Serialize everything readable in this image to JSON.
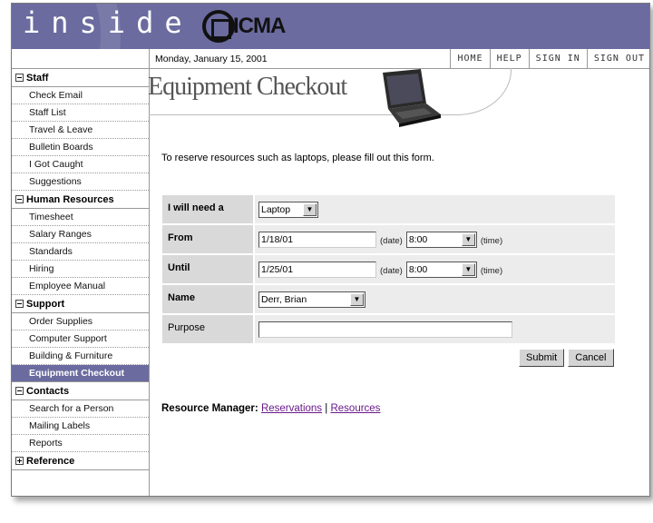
{
  "banner": {
    "word": "inside",
    "logo_text": "ICMA"
  },
  "topbar": {
    "date": "Monday, January 15, 2001",
    "links": [
      "HOME",
      "HELP",
      "SIGN IN",
      "SIGN OUT"
    ]
  },
  "sidebar": {
    "sections": [
      {
        "title": "Staff",
        "expanded": true,
        "items": [
          "Check Email",
          "Staff List",
          "Travel & Leave",
          "Bulletin Boards",
          "I Got Caught",
          "Suggestions"
        ]
      },
      {
        "title": "Human Resources",
        "expanded": true,
        "items": [
          "Timesheet",
          "Salary Ranges",
          "Standards",
          "Hiring",
          "Employee Manual"
        ]
      },
      {
        "title": "Support",
        "expanded": true,
        "items": [
          "Order Supplies",
          "Computer Support",
          "Building & Furniture",
          "Equipment Checkout"
        ]
      },
      {
        "title": "Contacts",
        "expanded": true,
        "items": [
          "Search for a Person",
          "Mailing Labels",
          "Reports"
        ]
      },
      {
        "title": "Reference",
        "expanded": false,
        "items": []
      }
    ],
    "active_item": "Equipment Checkout"
  },
  "page": {
    "title": "Equipment Checkout",
    "intro": "To reserve resources such as laptops, please fill out this form."
  },
  "form": {
    "need_label": "I will need a",
    "need_value": "Laptop",
    "from_label": "From",
    "from_date": "1/18/01",
    "from_time": "8:00",
    "until_label": "Until",
    "until_date": "1/25/01",
    "until_time": "8:00",
    "date_hint": "(date)",
    "time_hint": "(time)",
    "name_label": "Name",
    "name_value": "Derr, Brian",
    "purpose_label": "Purpose",
    "purpose_value": "",
    "submit_label": "Submit",
    "cancel_label": "Cancel"
  },
  "resource_manager": {
    "label": "Resource Manager:",
    "link1": "Reservations",
    "separator": "|",
    "link2": "Resources"
  },
  "colors": {
    "banner": "#6b6ba0",
    "active": "#6b6ba0",
    "link": "#6a1a8a"
  }
}
